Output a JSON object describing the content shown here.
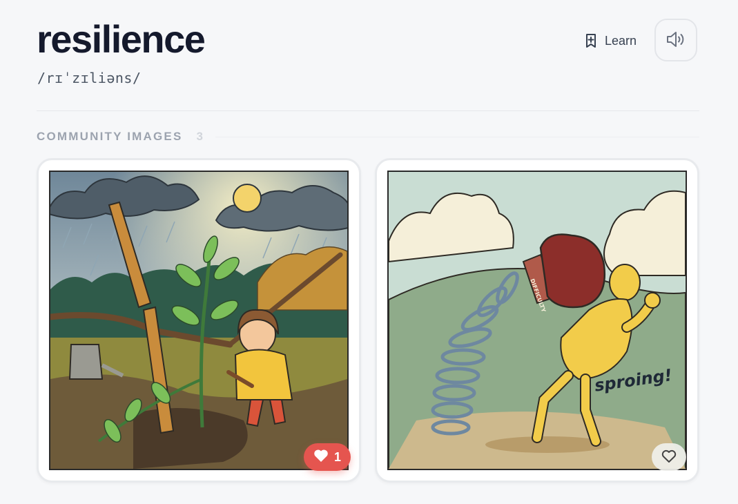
{
  "word": {
    "title": "resilience",
    "pronunciation": "/rɪˈzɪliəns/"
  },
  "actions": {
    "learn_label": "Learn",
    "learn_icon": "bookmark-plus-icon",
    "audio_icon": "speaker-icon"
  },
  "community": {
    "title": "COMMUNITY IMAGES",
    "count": "3",
    "images": [
      {
        "alt": "Child tending a sprouting plant next to a broken stake after a storm",
        "likes": "1",
        "liked": true
      },
      {
        "alt": "Cartoon figure springing back after a boxing glove labeled DIFFICULTY hits it",
        "glove_label": "DIFFICULTY",
        "sfx": "sproing!",
        "liked": false
      }
    ]
  },
  "colors": {
    "like_active": "#e5554f",
    "title": "#151a2d",
    "muted": "#9ca3af"
  }
}
